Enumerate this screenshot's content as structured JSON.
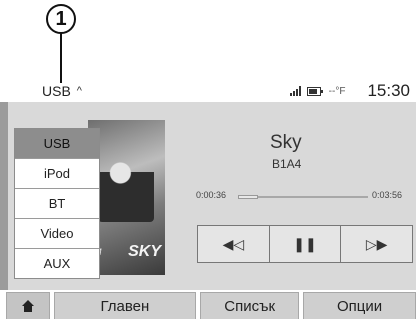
{
  "callout": "1",
  "topbar": {
    "source_label": "USB",
    "source_caret": "^",
    "temperature": "--°F",
    "clock": "15:30"
  },
  "source_menu": [
    {
      "label": "USB",
      "active": true
    },
    {
      "label": "iPod",
      "active": false
    },
    {
      "label": "BT",
      "active": false
    },
    {
      "label": "Video",
      "active": false
    },
    {
      "label": "AUX",
      "active": false
    }
  ],
  "album_art": {
    "text": "SKY",
    "small_text": "M"
  },
  "track": {
    "title": "Sky",
    "subtitle": "B1A4",
    "elapsed": "0:00:36",
    "total": "0:03:56",
    "progress_fraction": 0.15
  },
  "controls": {
    "prev": "◀◁",
    "pause": "❚❚",
    "next": "▷▶"
  },
  "tabs": {
    "main": "Главен",
    "list": "Списък",
    "options": "Опции"
  },
  "icons": [
    "home-icon",
    "signal-icon",
    "battery-icon",
    "chevron-up-icon"
  ]
}
